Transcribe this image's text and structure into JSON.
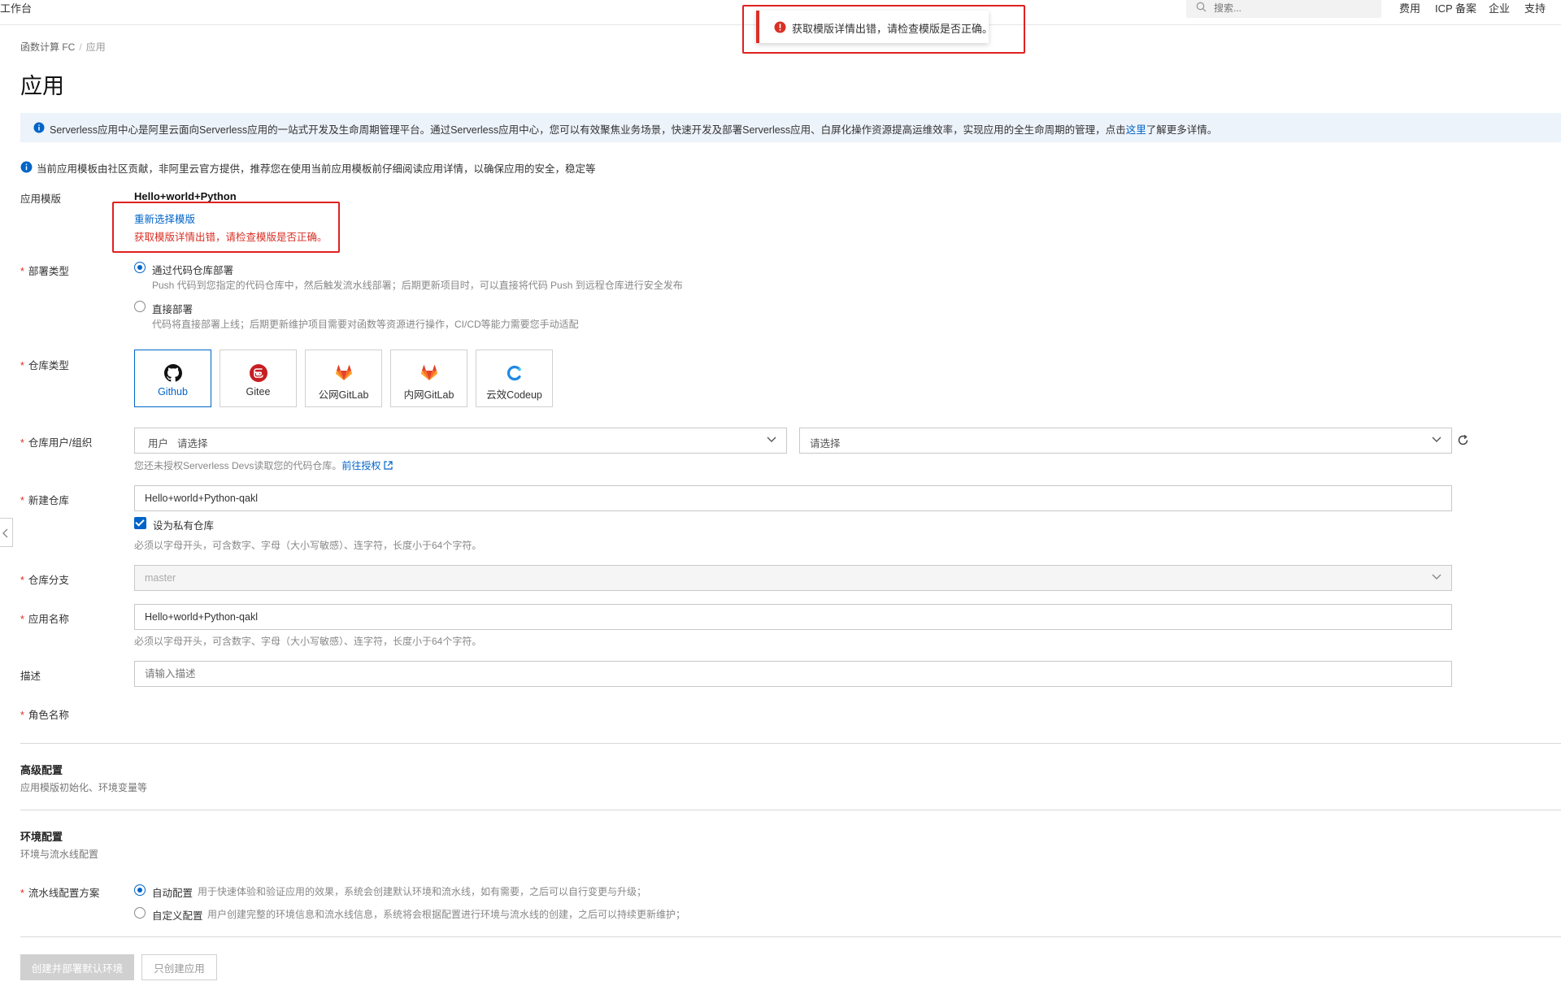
{
  "topbar": {
    "workbench": "工作台",
    "search_placeholder": "搜索...",
    "nav": [
      "费用",
      "ICP 备案",
      "企业",
      "支持"
    ]
  },
  "toast": {
    "message": "获取模版详情出错，请检查模版是否正确。"
  },
  "breadcrumb": {
    "root": "函数计算 FC",
    "sep": "/",
    "current": "应用"
  },
  "page_title": "应用",
  "info_banner": {
    "text": "Serverless应用中心是阿里云面向Serverless应用的一站式开发及生命周期管理平台。通过Serverless应用中心，您可以有效聚焦业务场景，快速开发及部署Serverless应用、白屏化操作资源提高运维效率，实现应用的全生命周期的管理，点击",
    "link": "这里",
    "suffix": "了解更多详情。"
  },
  "notice": "当前应用模板由社区贡献，非阿里云官方提供，推荐您在使用当前应用模板前仔细阅读应用详情，以确保应用的安全，稳定等",
  "template": {
    "label": "应用模版",
    "name": "Hello+world+Python",
    "reselect": "重新选择模版",
    "error": "获取模版详情出错，请检查模版是否正确。"
  },
  "deploy_type": {
    "label": "部署类型",
    "options": [
      {
        "title": "通过代码仓库部署",
        "desc": "Push 代码到您指定的代码仓库中，然后触发流水线部署；后期更新项目时，可以直接将代码 Push 到远程仓库进行安全发布",
        "selected": true
      },
      {
        "title": "直接部署",
        "desc": "代码将直接部署上线；后期更新维护项目需要对函数等资源进行操作，CI/CD等能力需要您手动适配",
        "selected": false
      }
    ]
  },
  "repo_type": {
    "label": "仓库类型",
    "options": [
      {
        "name": "Github",
        "icon": "github-icon",
        "selected": true
      },
      {
        "name": "Gitee",
        "icon": "gitee-icon",
        "selected": false
      },
      {
        "name": "公网GitLab",
        "icon": "gitlab-icon",
        "selected": false
      },
      {
        "name": "内网GitLab",
        "icon": "gitlab-icon",
        "selected": false
      },
      {
        "name": "云效Codeup",
        "icon": "codeup-icon",
        "selected": false
      }
    ]
  },
  "repo_owner": {
    "label": "仓库用户/组织",
    "prefix": "用户",
    "placeholder1": "请选择",
    "placeholder2": "请选择",
    "hint": "您还未授权Serverless Devs读取您的代码仓库。",
    "hint_link": "前往授权"
  },
  "new_repo": {
    "label": "新建仓库",
    "value": "Hello+world+Python-qakl",
    "private_label": "设为私有仓库",
    "private_checked": true,
    "hint": "必须以字母开头，可含数字、字母（大小写敏感）、连字符，长度小于64个字符。"
  },
  "branch": {
    "label": "仓库分支",
    "value": "master"
  },
  "app_name": {
    "label": "应用名称",
    "value": "Hello+world+Python-qakl",
    "hint": "必须以字母开头，可含数字、字母（大小写敏感）、连字符，长度小于64个字符。"
  },
  "description": {
    "label": "描述",
    "placeholder": "请输入描述"
  },
  "role": {
    "label": "角色名称"
  },
  "advanced": {
    "title": "高级配置",
    "subtitle": "应用模版初始化、环境变量等"
  },
  "env": {
    "title": "环境配置",
    "subtitle": "环境与流水线配置"
  },
  "pipeline": {
    "label": "流水线配置方案",
    "options": [
      {
        "title": "自动配置",
        "desc": "用于快速体验和验证应用的效果，系统会创建默认环境和流水线，如有需要，之后可以自行变更与升级；",
        "selected": true
      },
      {
        "title": "自定义配置",
        "desc": "用户创建完整的环境信息和流水线信息，系统将会根据配置进行环境与流水线的创建，之后可以持续更新维护；",
        "selected": false
      }
    ]
  },
  "buttons": {
    "create_deploy": "创建并部署默认环境",
    "create_only": "只创建应用"
  },
  "colors": {
    "accent": "#0064c8",
    "error": "#d93026",
    "banner_bg": "#edf3fb"
  }
}
